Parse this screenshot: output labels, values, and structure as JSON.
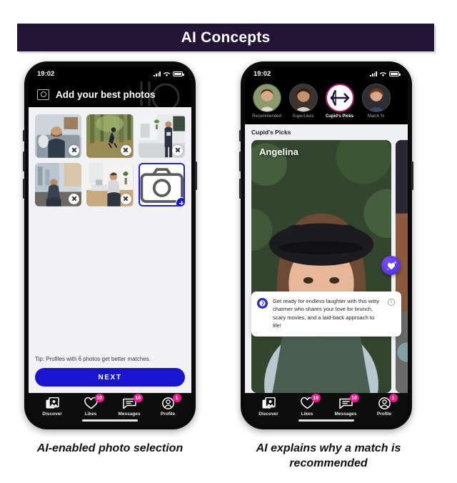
{
  "banner": {
    "title": "AI Concepts",
    "bg_color": "#241436",
    "text_color": "#ffffff"
  },
  "colors": {
    "accent_blue": "#1a14cf",
    "badge_pink": "#ef1a8e",
    "active_ring": "#b7177d",
    "screen_bg": "#f2f2f6"
  },
  "left_phone": {
    "status": {
      "time": "19:02",
      "signal_icon": "cellular-bars-icon",
      "wifi_icon": "wifi-icon",
      "battery_icon": "battery-icon"
    },
    "header": {
      "icon": "photo-library-icon",
      "title": "Add your best photos"
    },
    "photos": [
      {
        "alt": "man-sitting-couch",
        "delete_label": "x"
      },
      {
        "alt": "man-running-forest",
        "delete_label": "x"
      },
      {
        "alt": "man-standing-office-plants",
        "delete_label": "x"
      },
      {
        "alt": "man-sitting-city-window",
        "delete_label": "x"
      },
      {
        "alt": "man-at-desk-laptop",
        "delete_label": "x"
      }
    ],
    "add_tile": {
      "icon": "camera-icon",
      "badge": "+"
    },
    "tip": "Tip: Profiles with 6 photos get better matches.",
    "next_button": "NEXT",
    "tabs": [
      {
        "label": "Discover",
        "icon": "discover-icon",
        "badge": ""
      },
      {
        "label": "Likes",
        "icon": "heart-icon",
        "badge": "10"
      },
      {
        "label": "Messages",
        "icon": "message-icon",
        "badge": "10"
      },
      {
        "label": "Profile",
        "icon": "profile-icon",
        "badge": "1"
      }
    ]
  },
  "right_phone": {
    "status": {
      "time": "19:02",
      "signal_icon": "cellular-bars-icon",
      "wifi_icon": "wifi-icon",
      "battery_icon": "battery-icon"
    },
    "stories": [
      {
        "label": "Recommended",
        "active": false,
        "icon": "woman-portrait-1"
      },
      {
        "label": "SuperLikes",
        "active": false,
        "icon": "woman-portrait-2"
      },
      {
        "label": "Cupid's Picks",
        "active": true,
        "icon": "bow-arrow-icon"
      },
      {
        "label": "Match %",
        "active": false,
        "icon": "woman-portrait-3"
      }
    ],
    "section_title": "Cupid's Picks",
    "card": {
      "name": "Angelina",
      "alt": "woman-with-black-hat-portrait"
    },
    "spark_button": {
      "icon": "sparkle-heart-icon"
    },
    "ai_tip": {
      "avatar_icon": "ai-assistant-icon",
      "text": "Get ready for endless laughter with this witty charmer who shares your love for brunch, scary movies, and a laid-back approach to life!",
      "info_icon": "info-icon",
      "info_label": "i"
    },
    "tabs": [
      {
        "label": "Discover",
        "icon": "discover-icon",
        "badge": ""
      },
      {
        "label": "Likes",
        "icon": "heart-icon",
        "badge": "10"
      },
      {
        "label": "Messages",
        "icon": "message-icon",
        "badge": "10"
      },
      {
        "label": "Profile",
        "icon": "profile-icon",
        "badge": "1"
      }
    ]
  },
  "captions": {
    "left": "AI-enabled photo selection",
    "right": "AI explains why a match is recommended"
  }
}
